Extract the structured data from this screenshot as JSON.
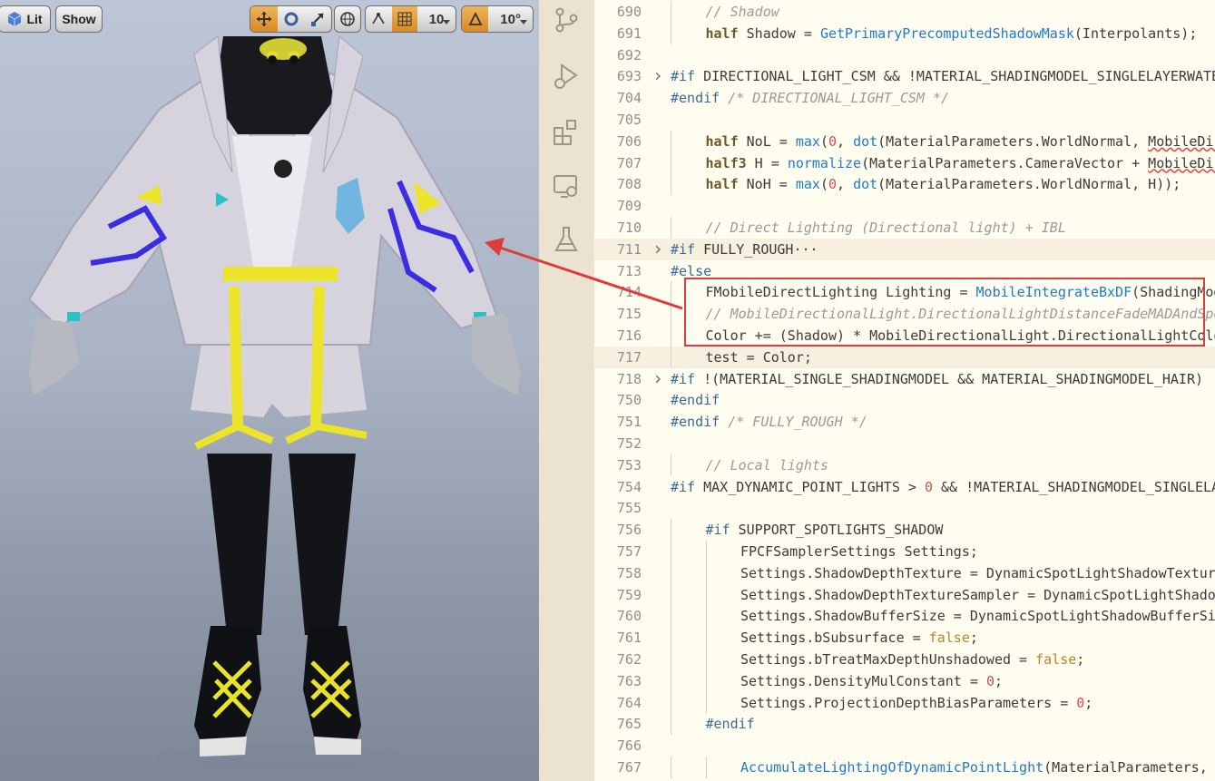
{
  "viewport": {
    "toolbar": {
      "lit_label": "Lit",
      "show_label": "Show",
      "grid_size": "10",
      "angle_snap": "10°"
    }
  },
  "editor": {
    "lines": [
      {
        "n": "690",
        "indent": 1,
        "segs": [
          {
            "t": "// Shadow",
            "c": "cm"
          }
        ]
      },
      {
        "n": "691",
        "indent": 1,
        "segs": [
          {
            "t": "half",
            "c": "kw"
          },
          {
            "t": " Shadow = "
          },
          {
            "t": "GetPrimaryPrecomputedShadowMask",
            "c": "fn"
          },
          {
            "t": "(Interpolants);"
          }
        ]
      },
      {
        "n": "692",
        "indent": 0,
        "segs": []
      },
      {
        "n": "693",
        "indent": 0,
        "fold": true,
        "segs": [
          {
            "t": "#if",
            "c": "pp"
          },
          {
            "t": " DIRECTIONAL_LIGHT_CSM && !MATERIAL_SHADINGMODEL_SINGLELAYERWATER"
          }
        ]
      },
      {
        "n": "704",
        "indent": 0,
        "segs": [
          {
            "t": "#endif",
            "c": "pp"
          },
          {
            "t": " "
          },
          {
            "t": "/* DIRECTIONAL_LIGHT_CSM */",
            "c": "cm"
          }
        ]
      },
      {
        "n": "705",
        "indent": 0,
        "segs": []
      },
      {
        "n": "706",
        "indent": 1,
        "segs": [
          {
            "t": "half",
            "c": "kw"
          },
          {
            "t": " NoL = "
          },
          {
            "t": "max",
            "c": "fn"
          },
          {
            "t": "("
          },
          {
            "t": "0",
            "c": "nm"
          },
          {
            "t": ", "
          },
          {
            "t": "dot",
            "c": "fn"
          },
          {
            "t": "(MaterialParameters.WorldNormal, "
          },
          {
            "t": "MobileDirectionalLight",
            "c": "squig"
          }
        ]
      },
      {
        "n": "707",
        "indent": 1,
        "segs": [
          {
            "t": "half3",
            "c": "kw"
          },
          {
            "t": " H = "
          },
          {
            "t": "normalize",
            "c": "fn"
          },
          {
            "t": "(MaterialParameters.CameraVector + "
          },
          {
            "t": "MobileDirectionalLight",
            "c": "squig"
          }
        ]
      },
      {
        "n": "708",
        "indent": 1,
        "segs": [
          {
            "t": "half",
            "c": "kw"
          },
          {
            "t": " NoH = "
          },
          {
            "t": "max",
            "c": "fn"
          },
          {
            "t": "("
          },
          {
            "t": "0",
            "c": "nm"
          },
          {
            "t": ", "
          },
          {
            "t": "dot",
            "c": "fn"
          },
          {
            "t": "(MaterialParameters.WorldNormal, H));"
          }
        ]
      },
      {
        "n": "709",
        "indent": 0,
        "segs": []
      },
      {
        "n": "710",
        "indent": 1,
        "segs": [
          {
            "t": "// Direct Lighting (Directional light) + IBL",
            "c": "cm"
          }
        ]
      },
      {
        "n": "711",
        "indent": 0,
        "fold": true,
        "hl": true,
        "segs": [
          {
            "t": "#if",
            "c": "pp"
          },
          {
            "t": " FULLY_ROUGH···"
          }
        ]
      },
      {
        "n": "713",
        "indent": 0,
        "segs": [
          {
            "t": "#else",
            "c": "pp"
          }
        ]
      },
      {
        "n": "714",
        "indent": 1,
        "segs": [
          {
            "t": "FMobileDirectLighting Lighting = "
          },
          {
            "t": "MobileIntegrateBxDF",
            "c": "fn"
          },
          {
            "t": "(ShadingModelContext, GBuffer"
          }
        ]
      },
      {
        "n": "715",
        "indent": 1,
        "segs": [
          {
            "t": "// MobileDirectionalLight.DirectionalLightDistanceFadeMADAndSpecularScale",
            "c": "cm"
          }
        ]
      },
      {
        "n": "716",
        "indent": 1,
        "segs": [
          {
            "t": "Color += (Shadow) * MobileDirectionalLight.DirectionalLightColor"
          }
        ]
      },
      {
        "n": "717",
        "indent": 1,
        "hl": true,
        "segs": [
          {
            "t": "test = Color;"
          }
        ]
      },
      {
        "n": "718",
        "indent": 0,
        "fold": true,
        "segs": [
          {
            "t": "#if",
            "c": "pp"
          },
          {
            "t": " !(MATERIAL_SINGLE_SHADINGMODEL && MATERIAL_SHADINGMODEL_HAIR)"
          }
        ]
      },
      {
        "n": "750",
        "indent": 0,
        "segs": [
          {
            "t": "#endif",
            "c": "pp"
          }
        ]
      },
      {
        "n": "751",
        "indent": 0,
        "segs": [
          {
            "t": "#endif",
            "c": "pp"
          },
          {
            "t": " "
          },
          {
            "t": "/* FULLY_ROUGH */",
            "c": "cm"
          }
        ]
      },
      {
        "n": "752",
        "indent": 0,
        "segs": []
      },
      {
        "n": "753",
        "indent": 1,
        "segs": [
          {
            "t": "// Local lights",
            "c": "cm"
          }
        ]
      },
      {
        "n": "754",
        "indent": 0,
        "segs": [
          {
            "t": "#if",
            "c": "pp"
          },
          {
            "t": " MAX_DYNAMIC_POINT_LIGHTS > "
          },
          {
            "t": "0",
            "c": "nm"
          },
          {
            "t": " && !MATERIAL_SHADINGMODEL_SINGLELAYERWATER"
          }
        ]
      },
      {
        "n": "755",
        "indent": 0,
        "segs": []
      },
      {
        "n": "756",
        "indent": 1,
        "segs": [
          {
            "t": "#if",
            "c": "pp"
          },
          {
            "t": " SUPPORT_SPOTLIGHTS_SHADOW"
          }
        ]
      },
      {
        "n": "757",
        "indent": 2,
        "segs": [
          {
            "t": "FPCFSamplerSettings Settings;"
          }
        ]
      },
      {
        "n": "758",
        "indent": 2,
        "segs": [
          {
            "t": "Settings.ShadowDepthTexture = DynamicSpotLightShadowTexture;"
          }
        ]
      },
      {
        "n": "759",
        "indent": 2,
        "segs": [
          {
            "t": "Settings.ShadowDepthTextureSampler = DynamicSpotLightShadowSampler;"
          }
        ]
      },
      {
        "n": "760",
        "indent": 2,
        "segs": [
          {
            "t": "Settings.ShadowBufferSize = DynamicSpotLightShadowBufferSize;"
          }
        ]
      },
      {
        "n": "761",
        "indent": 2,
        "segs": [
          {
            "t": "Settings.bSubsurface = "
          },
          {
            "t": "false",
            "c": "bl"
          },
          {
            "t": ";"
          }
        ]
      },
      {
        "n": "762",
        "indent": 2,
        "segs": [
          {
            "t": "Settings.bTreatMaxDepthUnshadowed = "
          },
          {
            "t": "false",
            "c": "bl"
          },
          {
            "t": ";"
          }
        ]
      },
      {
        "n": "763",
        "indent": 2,
        "segs": [
          {
            "t": "Settings.DensityMulConstant = "
          },
          {
            "t": "0",
            "c": "nm"
          },
          {
            "t": ";"
          }
        ]
      },
      {
        "n": "764",
        "indent": 2,
        "segs": [
          {
            "t": "Settings.ProjectionDepthBiasParameters = "
          },
          {
            "t": "0",
            "c": "nm"
          },
          {
            "t": ";"
          }
        ]
      },
      {
        "n": "765",
        "indent": 1,
        "segs": [
          {
            "t": "#endif",
            "c": "pp"
          }
        ]
      },
      {
        "n": "766",
        "indent": 0,
        "segs": []
      },
      {
        "n": "767",
        "indent": 2,
        "segs": [
          {
            "t": "AccumulateLightingOfDynamicPointLight",
            "c": "fn"
          },
          {
            "t": "(MaterialParameters, GBuffer"
          }
        ]
      }
    ]
  }
}
